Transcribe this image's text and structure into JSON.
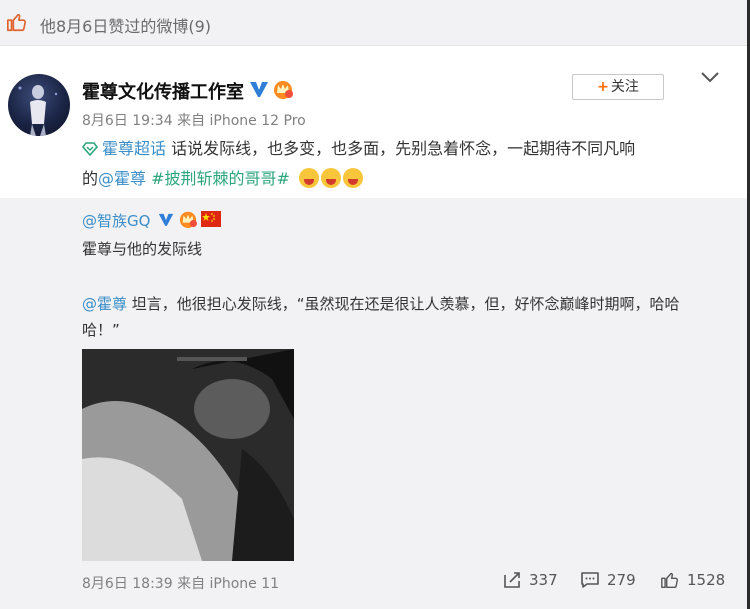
{
  "header": {
    "liked_text": "他8月6日赞过的微博(9)"
  },
  "post": {
    "author": "霍尊文化传播工作室",
    "time": "8月6日 19:34",
    "source_prefix": "来自",
    "source": "iPhone 12 Pro",
    "follow_label": "关注",
    "follow_plus": "+",
    "chaohua": "霍尊超话",
    "line1_rest": "话说发际线，也多变，也多面，先别急着怀念，一起期待不同凡响",
    "line2_prefix": "的",
    "mention": "@霍尊",
    "hashtag": "#披荆斩棘的哥哥#"
  },
  "repost": {
    "author": "@智族GQ",
    "subtitle": "霍尊与他的发际线",
    "mention": "@霍尊",
    "body_rest": " 坦言，他很担心发际线，“虽然现在还是很让人羡慕，但，好怀念巅峰时期啊，哈哈哈！”",
    "time": "8月6日 18:39",
    "source_prefix": "来自",
    "source": "iPhone 11",
    "repost_count": "337",
    "comment_count": "279",
    "like_count": "1528"
  },
  "colors": {
    "link_blue": "#3b8ec8",
    "hashtag_green": "#2da67d",
    "follow_plus": "#ff6a00"
  }
}
